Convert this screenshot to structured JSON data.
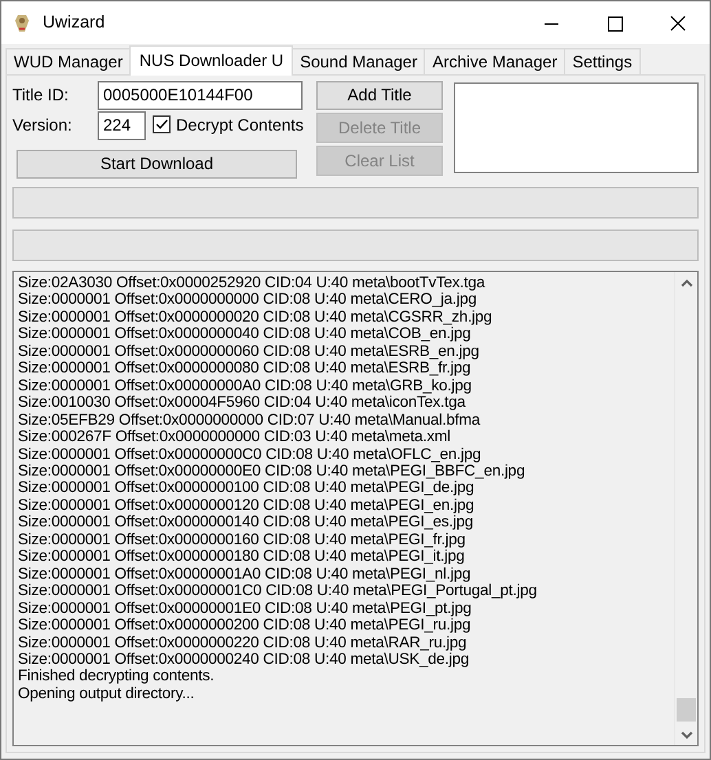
{
  "window": {
    "title": "Uwizard"
  },
  "tabs": [
    {
      "label": "WUD Manager",
      "selected": false
    },
    {
      "label": "NUS Downloader U",
      "selected": true
    },
    {
      "label": "Sound Manager",
      "selected": false
    },
    {
      "label": "Archive Manager",
      "selected": false
    },
    {
      "label": "Settings",
      "selected": false
    }
  ],
  "form": {
    "title_id_label": "Title ID:",
    "title_id_value": "0005000E10144F00",
    "version_label": "Version:",
    "version_value": "224",
    "decrypt": {
      "label": "Decrypt Contents",
      "checked": true
    },
    "start_button": {
      "label": "Start Download",
      "disabled": false
    }
  },
  "title_buttons": [
    {
      "label": "Add Title",
      "disabled": false
    },
    {
      "label": "Delete Title",
      "disabled": true
    },
    {
      "label": "Clear List",
      "disabled": true
    }
  ],
  "progress_bars": [
    {
      "level": 0
    },
    {
      "level": 0
    }
  ],
  "log_lines": [
    "Size:02A3030 Offset:0x0000252920 CID:04 U:40 meta\\bootTvTex.tga",
    "Size:0000001 Offset:0x0000000000 CID:08 U:40 meta\\CERO_ja.jpg",
    "Size:0000001 Offset:0x0000000020 CID:08 U:40 meta\\CGSRR_zh.jpg",
    "Size:0000001 Offset:0x0000000040 CID:08 U:40 meta\\COB_en.jpg",
    "Size:0000001 Offset:0x0000000060 CID:08 U:40 meta\\ESRB_en.jpg",
    "Size:0000001 Offset:0x0000000080 CID:08 U:40 meta\\ESRB_fr.jpg",
    "Size:0000001 Offset:0x00000000A0 CID:08 U:40 meta\\GRB_ko.jpg",
    "Size:0010030 Offset:0x00004F5960 CID:04 U:40 meta\\iconTex.tga",
    "Size:05EFB29 Offset:0x0000000000 CID:07 U:40 meta\\Manual.bfma",
    "Size:000267F Offset:0x0000000000 CID:03 U:40 meta\\meta.xml",
    "Size:0000001 Offset:0x00000000C0 CID:08 U:40 meta\\OFLC_en.jpg",
    "Size:0000001 Offset:0x00000000E0 CID:08 U:40 meta\\PEGI_BBFC_en.jpg",
    "Size:0000001 Offset:0x0000000100 CID:08 U:40 meta\\PEGI_de.jpg",
    "Size:0000001 Offset:0x0000000120 CID:08 U:40 meta\\PEGI_en.jpg",
    "Size:0000001 Offset:0x0000000140 CID:08 U:40 meta\\PEGI_es.jpg",
    "Size:0000001 Offset:0x0000000160 CID:08 U:40 meta\\PEGI_fr.jpg",
    "Size:0000001 Offset:0x0000000180 CID:08 U:40 meta\\PEGI_it.jpg",
    "Size:0000001 Offset:0x00000001A0 CID:08 U:40 meta\\PEGI_nl.jpg",
    "Size:0000001 Offset:0x00000001C0 CID:08 U:40 meta\\PEGI_Portugal_pt.jpg",
    "Size:0000001 Offset:0x00000001E0 CID:08 U:40 meta\\PEGI_pt.jpg",
    "Size:0000001 Offset:0x0000000200 CID:08 U:40 meta\\PEGI_ru.jpg",
    "Size:0000001 Offset:0x0000000220 CID:08 U:40 meta\\RAR_ru.jpg",
    "Size:0000001 Offset:0x0000000240 CID:08 U:40 meta\\USK_de.jpg",
    "Finished decrypting contents.",
    "Opening output directory..."
  ]
}
